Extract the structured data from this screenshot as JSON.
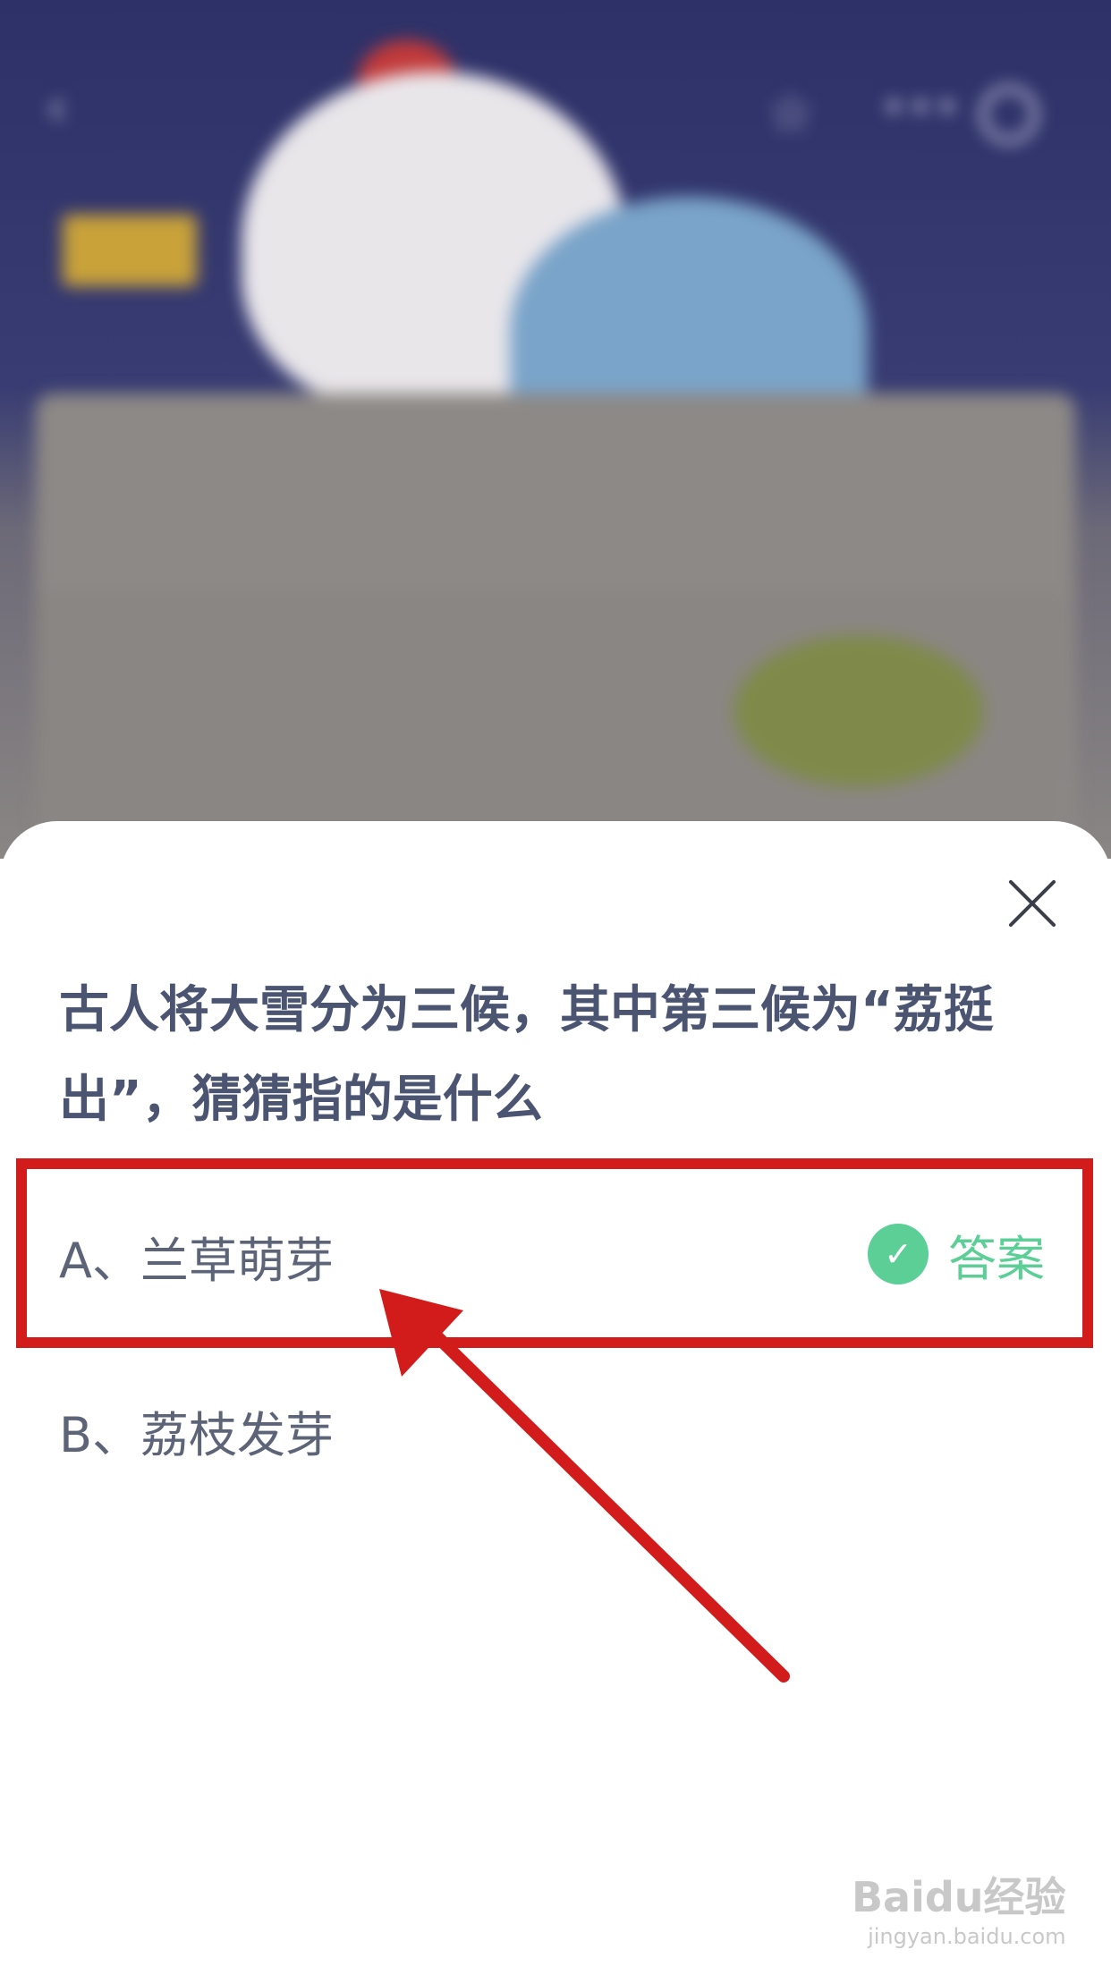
{
  "quiz": {
    "question": "古人将大雪分为三候，其中第三候为“荔挺出”，猜猜指的是什么",
    "options": [
      {
        "label": "A、兰草萌芽",
        "correct": true
      },
      {
        "label": "B、荔枝发芽",
        "correct": false
      }
    ],
    "answer_label": "答案"
  },
  "colors": {
    "accent_green": "#5ccf97",
    "annotation_red": "#d21c1c",
    "question_text": "#4b5572"
  },
  "icons": [
    "back-icon",
    "star-icon",
    "more-icon",
    "target-icon",
    "close-icon",
    "check-icon"
  ],
  "watermark": {
    "brand": "Baidu经验",
    "url": "jingyan.baidu.com"
  }
}
